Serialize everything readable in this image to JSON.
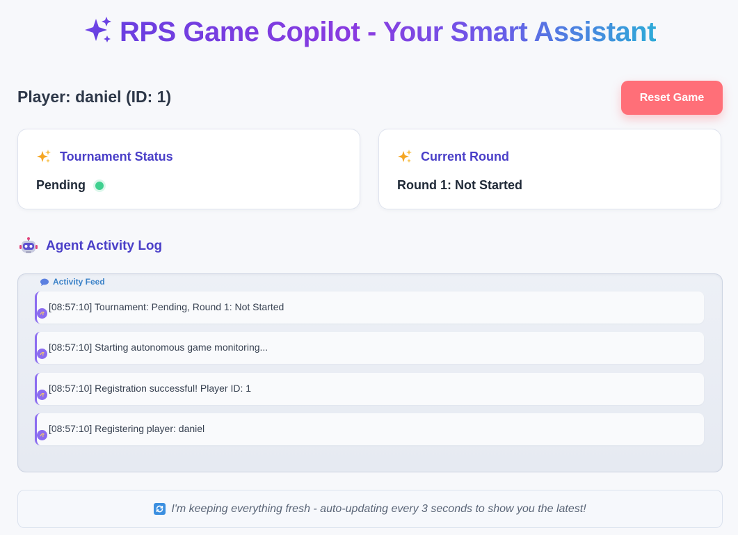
{
  "header": {
    "title": "RPS Game Copilot - Your Smart Assistant",
    "title_icon": "sparkles-icon",
    "gradient_colors": [
      "#6a3fe0",
      "#8a3be0",
      "#2eaad8"
    ]
  },
  "player": {
    "label": "Player: daniel (ID: 1)"
  },
  "actions": {
    "reset_label": "Reset Game",
    "reset_color": "#ff6f78"
  },
  "tournament_card": {
    "title": "Tournament Status",
    "icon": "sparkles-icon",
    "value": "Pending",
    "status_color": "#3fd08f"
  },
  "round_card": {
    "title": "Current Round",
    "icon": "sparkles-icon",
    "value": "Round 1: Not Started"
  },
  "activity_log": {
    "heading": "Agent Activity Log",
    "icon": "robot-icon",
    "feed_label": "Activity Feed",
    "feed_icon": "speech-bubble-icon",
    "entries": [
      {
        "text": "[08:57:10] Tournament: Pending, Round 1: Not Started"
      },
      {
        "text": "[08:57:10] Starting autonomous game monitoring..."
      },
      {
        "text": "[08:57:10] Registration successful! Player ID: 1"
      },
      {
        "text": "[08:57:10] Registering player: daniel"
      }
    ]
  },
  "footer": {
    "icon": "refresh-icon",
    "text": "I'm keeping everything fresh - auto-updating every 3 seconds to show you the latest!"
  }
}
